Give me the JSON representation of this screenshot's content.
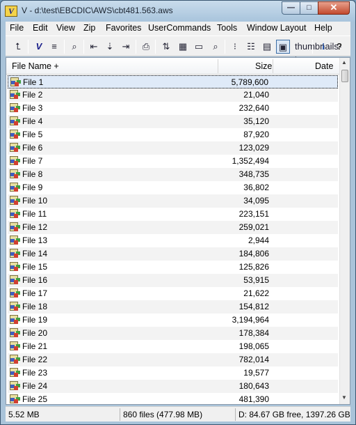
{
  "window": {
    "title": "V - d:\\test\\EBCDIC\\AWS\\cbt481.563.aws",
    "app_icon": "V"
  },
  "controls": {
    "minimize": "—",
    "maximize": "□",
    "close": "✕"
  },
  "menu": [
    "File",
    "Edit",
    "View",
    "Zip",
    "Favorites",
    "UserCommands",
    "Tools",
    "Window Layout",
    "Help"
  ],
  "toolbar_icons": [
    {
      "name": "up-folder-icon",
      "glyph": "⮤"
    },
    {
      "name": "v-logo-icon",
      "glyph": "V"
    },
    {
      "name": "hex-view-icon",
      "glyph": "≡"
    },
    {
      "name": "binoculars-icon",
      "glyph": "⌕"
    },
    {
      "name": "nav-left-icon",
      "glyph": "⇤"
    },
    {
      "name": "nav-down-icon",
      "glyph": "⇣"
    },
    {
      "name": "nav-right-icon",
      "glyph": "⇥"
    },
    {
      "name": "print-icon",
      "glyph": "⎙"
    },
    {
      "name": "sort-icon",
      "glyph": "⇅"
    },
    {
      "name": "calculator-icon",
      "glyph": "▦"
    },
    {
      "name": "window-icon",
      "glyph": "▭"
    },
    {
      "name": "find-icon",
      "glyph": "⌕"
    },
    {
      "name": "small-icons-icon",
      "glyph": "⁝"
    },
    {
      "name": "list-view-icon",
      "glyph": "☷"
    },
    {
      "name": "details-view-icon",
      "glyph": "▤"
    },
    {
      "name": "thumbnails-icon",
      "glyph": "▣"
    },
    {
      "name": "info-icon",
      "glyph": "i"
    },
    {
      "name": "help-icon",
      "glyph": "?"
    }
  ],
  "columns": {
    "name": "File Name +",
    "size": "Size",
    "date": "Date"
  },
  "files": [
    {
      "name": "File 1",
      "size": "5,789,600"
    },
    {
      "name": "File 2",
      "size": "21,040"
    },
    {
      "name": "File 3",
      "size": "232,640"
    },
    {
      "name": "File 4",
      "size": "35,120"
    },
    {
      "name": "File 5",
      "size": "87,920"
    },
    {
      "name": "File 6",
      "size": "123,029"
    },
    {
      "name": "File 7",
      "size": "1,352,494"
    },
    {
      "name": "File 8",
      "size": "348,735"
    },
    {
      "name": "File 9",
      "size": "36,802"
    },
    {
      "name": "File 10",
      "size": "34,095"
    },
    {
      "name": "File 11",
      "size": "223,151"
    },
    {
      "name": "File 12",
      "size": "259,021"
    },
    {
      "name": "File 13",
      "size": "2,944"
    },
    {
      "name": "File 14",
      "size": "184,806"
    },
    {
      "name": "File 15",
      "size": "125,826"
    },
    {
      "name": "File 16",
      "size": "53,915"
    },
    {
      "name": "File 17",
      "size": "21,622"
    },
    {
      "name": "File 18",
      "size": "154,812"
    },
    {
      "name": "File 19",
      "size": "3,194,964"
    },
    {
      "name": "File 20",
      "size": "178,384"
    },
    {
      "name": "File 21",
      "size": "198,065"
    },
    {
      "name": "File 22",
      "size": "782,014"
    },
    {
      "name": "File 23",
      "size": "19,577"
    },
    {
      "name": "File 24",
      "size": "180,643"
    },
    {
      "name": "File 25",
      "size": "481,390"
    }
  ],
  "status": {
    "size": "5.52 MB",
    "files": "860 files (477.98 MB)",
    "disk": "D: 84.67 GB free, 1397.26 GB"
  }
}
